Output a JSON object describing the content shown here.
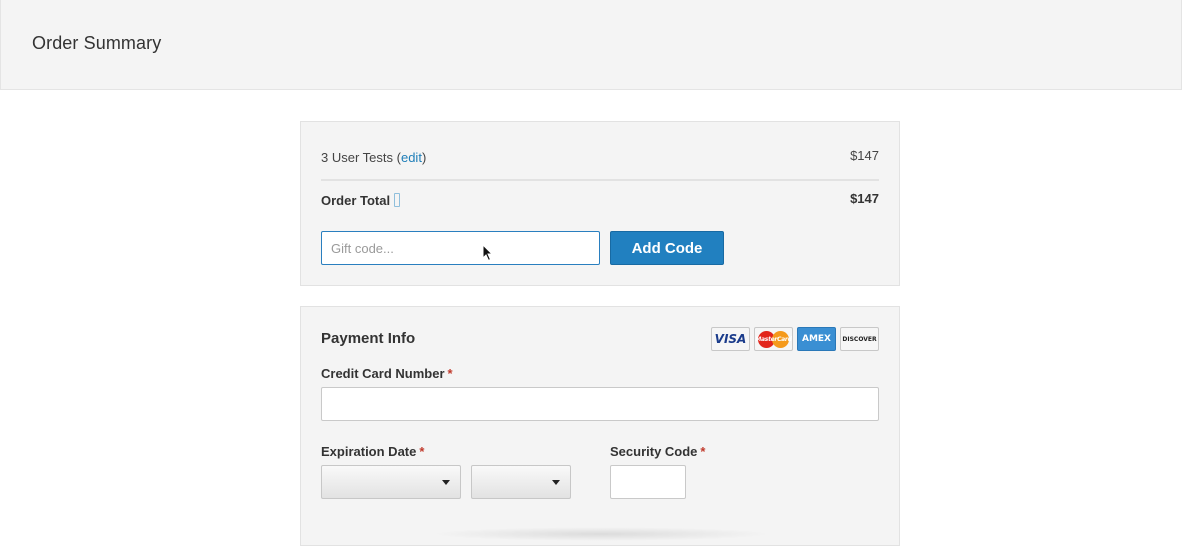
{
  "header": {
    "title": "Order Summary"
  },
  "order": {
    "item_label": "3 User Tests",
    "edit_link": "edit",
    "item_price": "$147",
    "total_label": "Order Total",
    "total_price": "$147",
    "gift_code_placeholder": "Gift code...",
    "add_code_label": "Add Code"
  },
  "payment": {
    "title": "Payment Info",
    "cards": [
      "VISA",
      "MasterCard",
      "AMEX",
      "DISCOVER"
    ],
    "credit_card_label": "Credit Card Number",
    "expiration_label": "Expiration Date",
    "security_label": "Security Code",
    "required_mark": "*"
  },
  "colors": {
    "accent": "#2180c0",
    "required": "#c0392b",
    "panel_bg": "#f4f4f4"
  }
}
